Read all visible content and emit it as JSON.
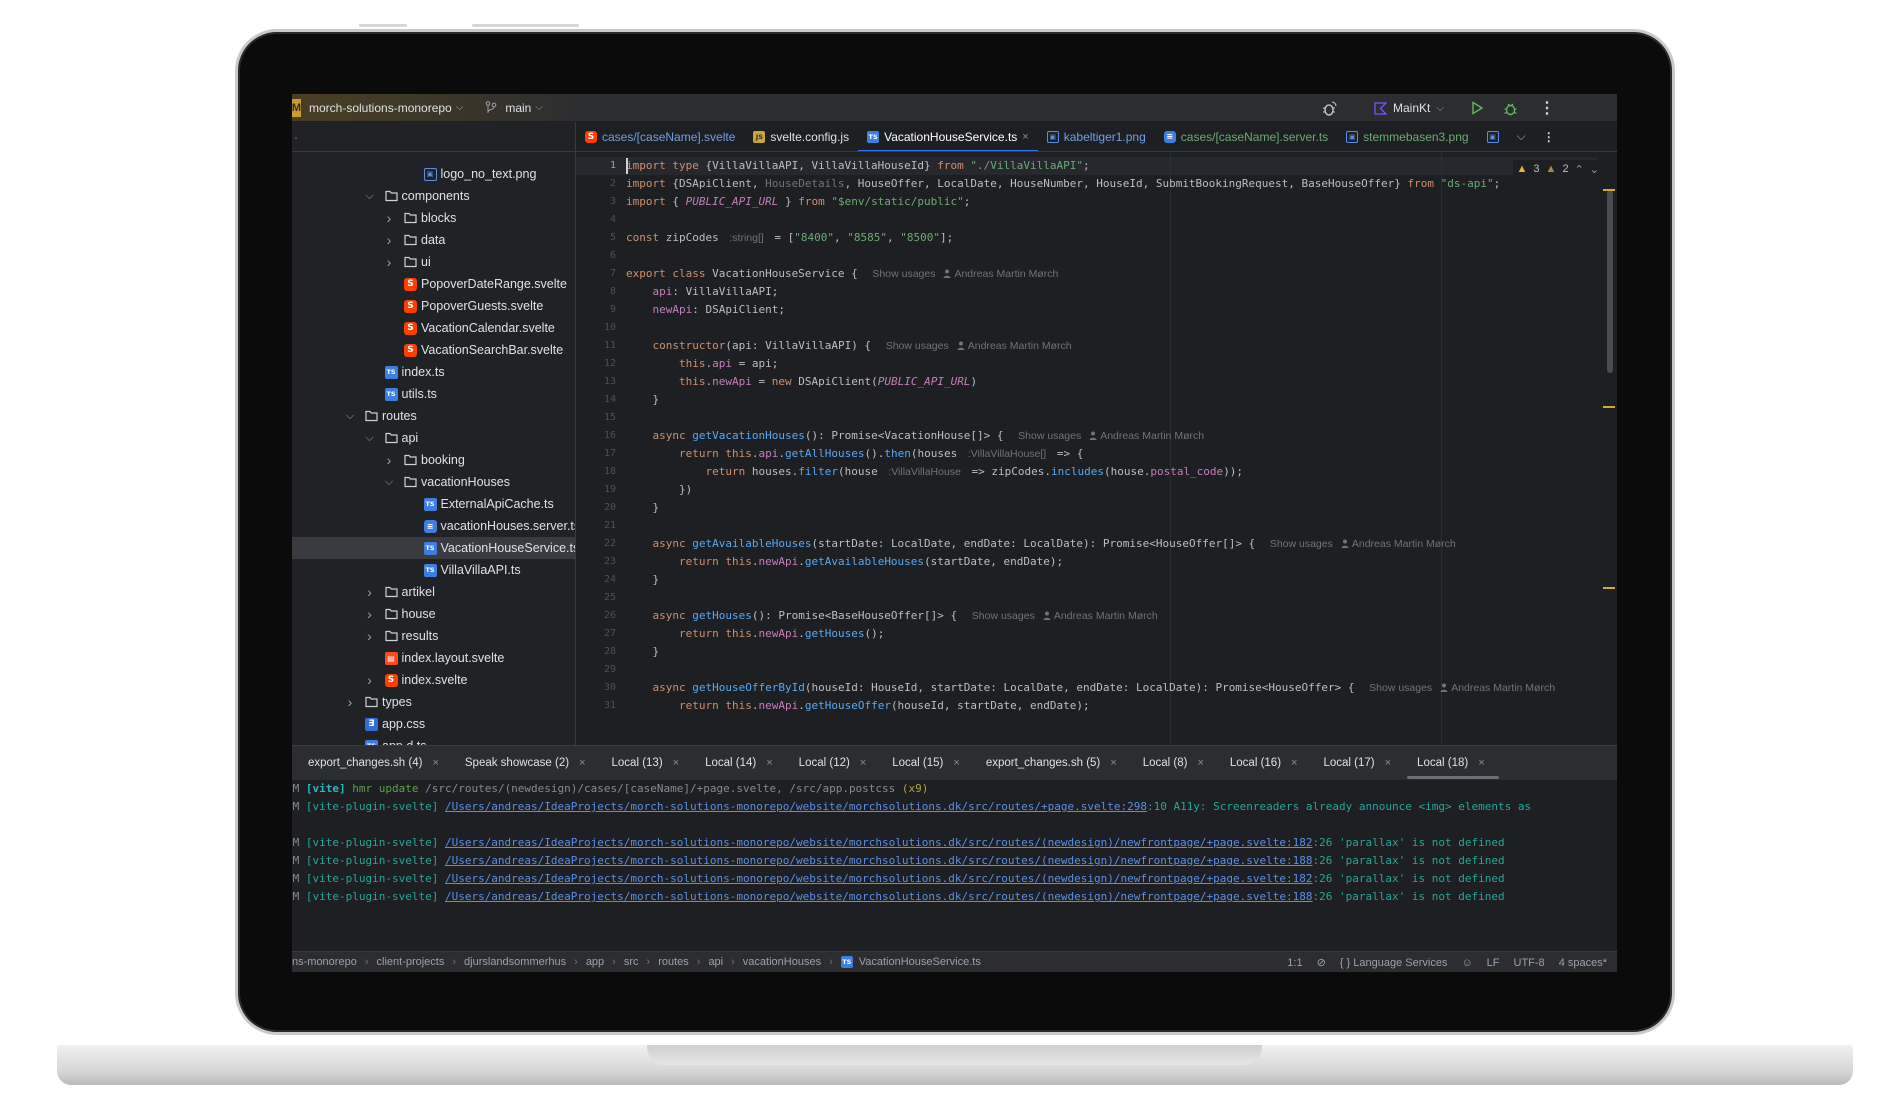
{
  "titlebar": {
    "project_badge": "M",
    "project": "morch-solutions-monorepo",
    "branch": "main",
    "run_config": "MainKt",
    "accent": "#c99a2e"
  },
  "editor_tabs": [
    {
      "label": "cases/[caseName].svelte",
      "icon": "svelte-icon",
      "color": "#6fa0e6"
    },
    {
      "label": "svelte.config.js",
      "icon": "js-icon",
      "color": "#dfe1e5"
    },
    {
      "label": "VacationHouseService.ts",
      "icon": "ts-icon",
      "color": "#ffffff",
      "active": true,
      "close": "×"
    },
    {
      "label": "kabeltiger1.png",
      "icon": "image-icon",
      "color": "#6fa0e6"
    },
    {
      "label": "cases/[caseName].server.ts",
      "icon": "server-ts-icon",
      "color": "#6aab73"
    },
    {
      "label": "stemmebasen3.png",
      "icon": "image-icon",
      "color": "#6aab73"
    }
  ],
  "tree": [
    {
      "label": "logo_no_text.png",
      "level": 3,
      "type": "image"
    },
    {
      "label": "components",
      "level": 1,
      "type": "folder",
      "expanded": true
    },
    {
      "label": "blocks",
      "level": 2,
      "type": "folder",
      "expanded": false
    },
    {
      "label": "data",
      "level": 2,
      "type": "folder",
      "expanded": false
    },
    {
      "label": "ui",
      "level": 2,
      "type": "folder",
      "expanded": false
    },
    {
      "label": "PopoverDateRange.svelte",
      "level": 2,
      "type": "svelte"
    },
    {
      "label": "PopoverGuests.svelte",
      "level": 2,
      "type": "svelte"
    },
    {
      "label": "VacationCalendar.svelte",
      "level": 2,
      "type": "svelte"
    },
    {
      "label": "VacationSearchBar.svelte",
      "level": 2,
      "type": "svelte"
    },
    {
      "label": "index.ts",
      "level": 1,
      "type": "ts"
    },
    {
      "label": "utils.ts",
      "level": 1,
      "type": "ts"
    },
    {
      "label": "routes",
      "level": 0,
      "type": "folder",
      "expanded": true
    },
    {
      "label": "api",
      "level": 1,
      "type": "folder",
      "expanded": true
    },
    {
      "label": "booking",
      "level": 2,
      "type": "folder",
      "expanded": false
    },
    {
      "label": "vacationHouses",
      "level": 2,
      "type": "folder",
      "expanded": true
    },
    {
      "label": "ExternalApiCache.ts",
      "level": 3,
      "type": "ts"
    },
    {
      "label": "vacationHouses.server.ts",
      "level": 3,
      "type": "srv"
    },
    {
      "label": "VacationHouseService.ts",
      "level": 3,
      "type": "ts",
      "selected": true
    },
    {
      "label": "VillaVillaAPI.ts",
      "level": 3,
      "type": "ts"
    },
    {
      "label": "artikel",
      "level": 1,
      "type": "folder",
      "expanded": false
    },
    {
      "label": "house",
      "level": 1,
      "type": "folder",
      "expanded": false
    },
    {
      "label": "results",
      "level": 1,
      "type": "folder",
      "expanded": false
    },
    {
      "label": "index.layout.svelte",
      "level": 1,
      "type": "lay"
    },
    {
      "label": "index.svelte",
      "level": 1,
      "type": "svelte",
      "expanded": false
    },
    {
      "label": "types",
      "level": 0,
      "type": "folder",
      "expanded": false
    },
    {
      "label": "app.css",
      "level": 0,
      "type": "css"
    },
    {
      "label": "app.d.ts",
      "level": 0,
      "type": "ts"
    }
  ],
  "editor": {
    "warnings": {
      "errors_count": "3",
      "warnings_count": "2"
    },
    "lines": [
      [
        [
          "kw",
          "import type "
        ],
        [
          "p",
          "{VillaVillaAPI, VillaVillaHouseId} "
        ],
        [
          "kw",
          "from "
        ],
        [
          "str",
          "\"./VillaVillaAPI\""
        ],
        [
          "p",
          ";"
        ]
      ],
      [
        [
          "kw",
          "import "
        ],
        [
          "p",
          "{DSApiClient, "
        ],
        [
          "dim",
          "HouseDetails"
        ],
        [
          "p",
          ", HouseOffer, LocalDate, HouseNumber, HouseId, SubmitBookingRequest, BaseHouseOffer} "
        ],
        [
          "kw",
          "from "
        ],
        [
          "str",
          "\"ds-api\""
        ],
        [
          "p",
          ";"
        ]
      ],
      [
        [
          "kw",
          "import "
        ],
        [
          "p",
          "{ "
        ],
        [
          "cst",
          "PUBLIC_API_URL"
        ],
        [
          "p",
          " } "
        ],
        [
          "kw",
          "from "
        ],
        [
          "str",
          "\"$env/static/public\""
        ],
        [
          "p",
          ";"
        ]
      ],
      [],
      [
        [
          "kw",
          "const "
        ],
        [
          "p",
          "zipCodes "
        ],
        [
          "hint",
          ":string[]"
        ],
        [
          "p",
          " = ["
        ],
        [
          "str",
          "\"8400\""
        ],
        [
          "p",
          ", "
        ],
        [
          "str",
          "\"8585\""
        ],
        [
          "p",
          ", "
        ],
        [
          "str",
          "\"8500\""
        ],
        [
          "p",
          "];"
        ]
      ],
      [],
      [
        [
          "kw",
          "export class "
        ],
        [
          "p",
          "VacationHouseService { "
        ],
        [
          "usage",
          "Show usages"
        ],
        [
          "author",
          "Andreas Martin Mørch"
        ]
      ],
      [
        [
          "p",
          "    "
        ],
        [
          "prop",
          "api"
        ],
        [
          "p",
          ": VillaVillaAPI;"
        ]
      ],
      [
        [
          "p",
          "    "
        ],
        [
          "prop",
          "newApi"
        ],
        [
          "p",
          ": DSApiClient;"
        ]
      ],
      [],
      [
        [
          "p",
          "    "
        ],
        [
          "kw",
          "constructor"
        ],
        [
          "p",
          "(api: VillaVillaAPI) { "
        ],
        [
          "usage",
          "Show usages"
        ],
        [
          "author",
          "Andreas Martin Mørch"
        ]
      ],
      [
        [
          "p",
          "        "
        ],
        [
          "kw",
          "this"
        ],
        [
          "p",
          "."
        ],
        [
          "prop",
          "api"
        ],
        [
          "p",
          " = api;"
        ]
      ],
      [
        [
          "p",
          "        "
        ],
        [
          "kw",
          "this"
        ],
        [
          "p",
          "."
        ],
        [
          "prop",
          "newApi"
        ],
        [
          "p",
          " = "
        ],
        [
          "kw",
          "new "
        ],
        [
          "p",
          "DSApiClient("
        ],
        [
          "cst",
          "PUBLIC_API_URL"
        ],
        [
          "p",
          ")"
        ]
      ],
      [
        [
          "p",
          "    }"
        ]
      ],
      [],
      [
        [
          "p",
          "    "
        ],
        [
          "kw",
          "async "
        ],
        [
          "fn",
          "getVacationHouses"
        ],
        [
          "p",
          "(): Promise<VacationHouse[]> { "
        ],
        [
          "usage",
          "Show usages"
        ],
        [
          "author",
          "Andreas Martin Mørch"
        ]
      ],
      [
        [
          "p",
          "        "
        ],
        [
          "kw",
          "return this"
        ],
        [
          "p",
          "."
        ],
        [
          "prop",
          "api"
        ],
        [
          "p",
          "."
        ],
        [
          "fn",
          "getAllHouses"
        ],
        [
          "p",
          "()."
        ],
        [
          "fn",
          "then"
        ],
        [
          "p",
          "(houses "
        ],
        [
          "hint",
          ":VillaVillaHouse[]"
        ],
        [
          "p",
          " => {"
        ]
      ],
      [
        [
          "p",
          "            "
        ],
        [
          "kw",
          "return "
        ],
        [
          "p",
          "houses."
        ],
        [
          "fn",
          "filter"
        ],
        [
          "p",
          "(house "
        ],
        [
          "hint",
          ":VillaVillaHouse"
        ],
        [
          "p",
          " => zipCodes."
        ],
        [
          "fn",
          "includes"
        ],
        [
          "p",
          "(house."
        ],
        [
          "prop",
          "postal_code"
        ],
        [
          "p",
          "));"
        ]
      ],
      [
        [
          "p",
          "        })"
        ]
      ],
      [
        [
          "p",
          "    }"
        ]
      ],
      [],
      [
        [
          "p",
          "    "
        ],
        [
          "kw",
          "async "
        ],
        [
          "fn",
          "getAvailableHouses"
        ],
        [
          "p",
          "(startDate: LocalDate, endDate: LocalDate): Promise<HouseOffer[]> { "
        ],
        [
          "usage",
          "Show usages"
        ],
        [
          "author",
          "Andreas Martin Mørch"
        ]
      ],
      [
        [
          "p",
          "        "
        ],
        [
          "kw",
          "return this"
        ],
        [
          "p",
          "."
        ],
        [
          "prop",
          "newApi"
        ],
        [
          "p",
          "."
        ],
        [
          "fn",
          "getAvailableHouses"
        ],
        [
          "p",
          "(startDate, endDate);"
        ]
      ],
      [
        [
          "p",
          "    }"
        ]
      ],
      [],
      [
        [
          "p",
          "    "
        ],
        [
          "kw",
          "async "
        ],
        [
          "fn",
          "getHouses"
        ],
        [
          "p",
          "(): Promise<BaseHouseOffer[]> { "
        ],
        [
          "usage",
          "Show usages"
        ],
        [
          "author",
          "Andreas Martin Mørch"
        ]
      ],
      [
        [
          "p",
          "        "
        ],
        [
          "kw",
          "return this"
        ],
        [
          "p",
          "."
        ],
        [
          "prop",
          "newApi"
        ],
        [
          "p",
          "."
        ],
        [
          "fn",
          "getHouses"
        ],
        [
          "p",
          "();"
        ]
      ],
      [
        [
          "p",
          "    }"
        ]
      ],
      [],
      [
        [
          "p",
          "    "
        ],
        [
          "kw",
          "async "
        ],
        [
          "fn",
          "getHouseOfferById"
        ],
        [
          "p",
          "(houseId: HouseId, startDate: LocalDate, endDate: LocalDate): Promise<HouseOffer> { "
        ],
        [
          "usage",
          "Show usages"
        ],
        [
          "author",
          "Andreas Martin Mørch"
        ]
      ],
      [
        [
          "p",
          "        "
        ],
        [
          "kw",
          "return this"
        ],
        [
          "p",
          "."
        ],
        [
          "prop",
          "newApi"
        ],
        [
          "p",
          "."
        ],
        [
          "fn",
          "getHouseOffer"
        ],
        [
          "p",
          "(houseId, startDate, endDate);"
        ]
      ]
    ]
  },
  "terminal_tabs": [
    {
      "label": "export_changes.sh (4)"
    },
    {
      "label": "Speak showcase (2)"
    },
    {
      "label": "Local (13)"
    },
    {
      "label": "Local (14)"
    },
    {
      "label": "Local (12)"
    },
    {
      "label": "Local (15)"
    },
    {
      "label": "export_changes.sh (5)"
    },
    {
      "label": "Local (8)"
    },
    {
      "label": "Local (16)"
    },
    {
      "label": "Local (17)"
    },
    {
      "label": "Local (18)",
      "active": true
    }
  ],
  "terminal_lines": [
    [
      [
        "gray",
        "PM "
      ],
      [
        "vite",
        "[vite] "
      ],
      [
        "green",
        "hmr update "
      ],
      [
        "gray",
        "/src/routes/(newdesign)/cases/[caseName]/+page.svelte, /src/app.postcss "
      ],
      [
        "yel",
        "(x9)"
      ]
    ],
    [
      [
        "gray",
        "PM "
      ],
      [
        "teal",
        "[vite-plugin-svelte] "
      ],
      [
        "link",
        "/Users/andreas/IdeaProjects/morch-solutions-monorepo/website/morchsolutions.dk/src/routes/+page.svelte:298"
      ],
      [
        "teal",
        ":10 A11y: Screenreaders already announce <img> elements as"
      ]
    ],
    [],
    [
      [
        "gray",
        "PM "
      ],
      [
        "teal",
        "[vite-plugin-svelte] "
      ],
      [
        "link",
        "/Users/andreas/IdeaProjects/morch-solutions-monorepo/website/morchsolutions.dk/src/routes/(newdesign)/newfrontpage/+page.svelte:182"
      ],
      [
        "teal",
        ":26 'parallax' is not defined"
      ]
    ],
    [
      [
        "gray",
        "PM "
      ],
      [
        "teal",
        "[vite-plugin-svelte] "
      ],
      [
        "link",
        "/Users/andreas/IdeaProjects/morch-solutions-monorepo/website/morchsolutions.dk/src/routes/(newdesign)/newfrontpage/+page.svelte:188"
      ],
      [
        "teal",
        ":26 'parallax' is not defined"
      ]
    ],
    [
      [
        "gray",
        "PM "
      ],
      [
        "teal",
        "[vite-plugin-svelte] "
      ],
      [
        "link",
        "/Users/andreas/IdeaProjects/morch-solutions-monorepo/website/morchsolutions.dk/src/routes/(newdesign)/newfrontpage/+page.svelte:182"
      ],
      [
        "teal",
        ":26 'parallax' is not defined"
      ]
    ],
    [
      [
        "gray",
        "PM "
      ],
      [
        "teal",
        "[vite-plugin-svelte] "
      ],
      [
        "link",
        "/Users/andreas/IdeaProjects/morch-solutions-monorepo/website/morchsolutions.dk/src/routes/(newdesign)/newfrontpage/+page.svelte:188"
      ],
      [
        "teal",
        ":26 'parallax' is not defined"
      ]
    ]
  ],
  "statusbar": {
    "breadcrumb": [
      "ns-monorepo",
      "client-projects",
      "djurslandsommerhus",
      "app",
      "src",
      "routes",
      "api",
      "vacationHouses",
      "VacationHouseService.ts"
    ],
    "position": "1:1",
    "language_services": "{ } Language Services",
    "line_ending": "LF",
    "encoding": "UTF-8",
    "indent": "4 spaces*"
  }
}
